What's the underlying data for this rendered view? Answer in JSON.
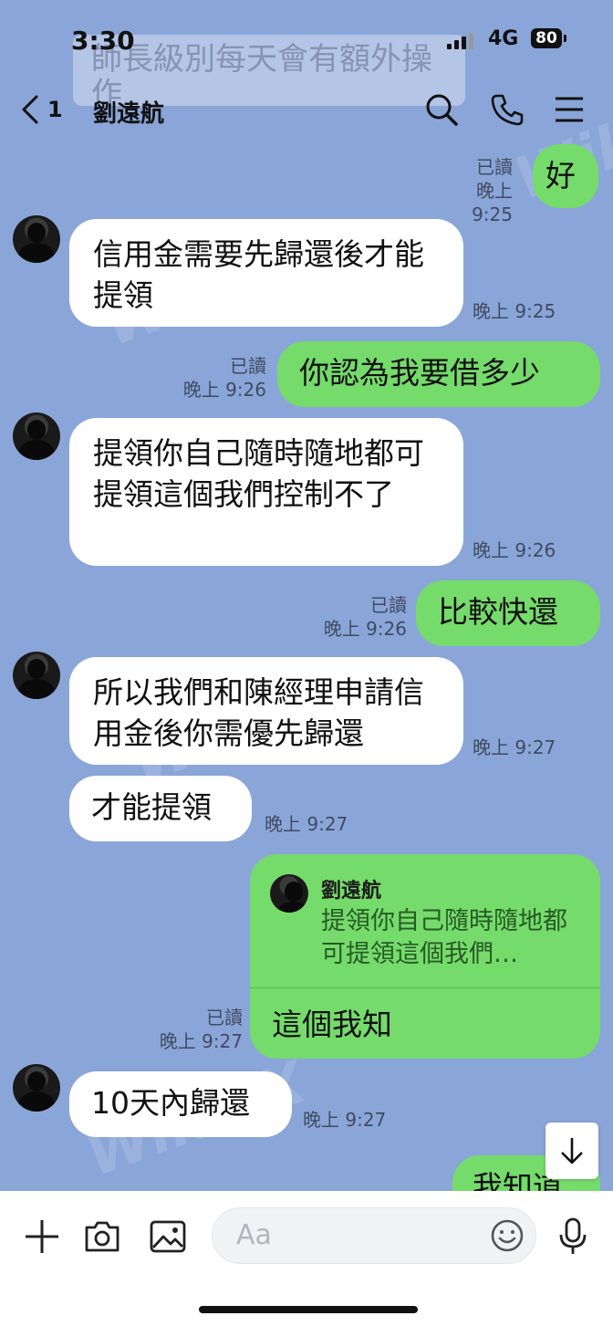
{
  "status_bar": {
    "time": "3:30",
    "network": "4G",
    "battery": "80"
  },
  "ghost_banner": "師長級別每天會有額外操作",
  "header": {
    "back_count": "1",
    "title": "劉遠航"
  },
  "messages": [
    {
      "side": "out",
      "text": "好",
      "read": "已讀",
      "time": "晚上 9:25"
    },
    {
      "side": "in",
      "text": "信用金需要先歸還後才能提領",
      "time": "晚上 9:25"
    },
    {
      "side": "out",
      "text": "你認為我要借多少",
      "read": "已讀",
      "time": "晚上 9:26"
    },
    {
      "side": "in",
      "text": "提領你自己隨時隨地都可提領這個我們控制不了",
      "time": "晚上 9:26"
    },
    {
      "side": "out",
      "text": "比較快還",
      "read": "已讀",
      "time": "晚上 9:26"
    },
    {
      "side": "in",
      "text": "所以我們和陳經理申請信用金後你需優先歸還",
      "time": "晚上 9:27"
    },
    {
      "side": "in",
      "text": "才能提領",
      "time": "晚上 9:27"
    },
    {
      "side": "out",
      "reply_name": "劉遠航",
      "reply_text": "提領你自己隨時隨地都可提領這個我們…",
      "text": "這個我知",
      "read": "已讀",
      "time": "晚上 9:27"
    },
    {
      "side": "in",
      "text": "10天內歸還",
      "time": "晚上 9:27"
    },
    {
      "side": "out",
      "text": "我知道"
    }
  ],
  "input": {
    "placeholder": "Aa"
  },
  "watermark": "WikiFX",
  "colors": {
    "background": "#8aa6d8",
    "outgoing": "#75db6b",
    "incoming": "#ffffff"
  }
}
